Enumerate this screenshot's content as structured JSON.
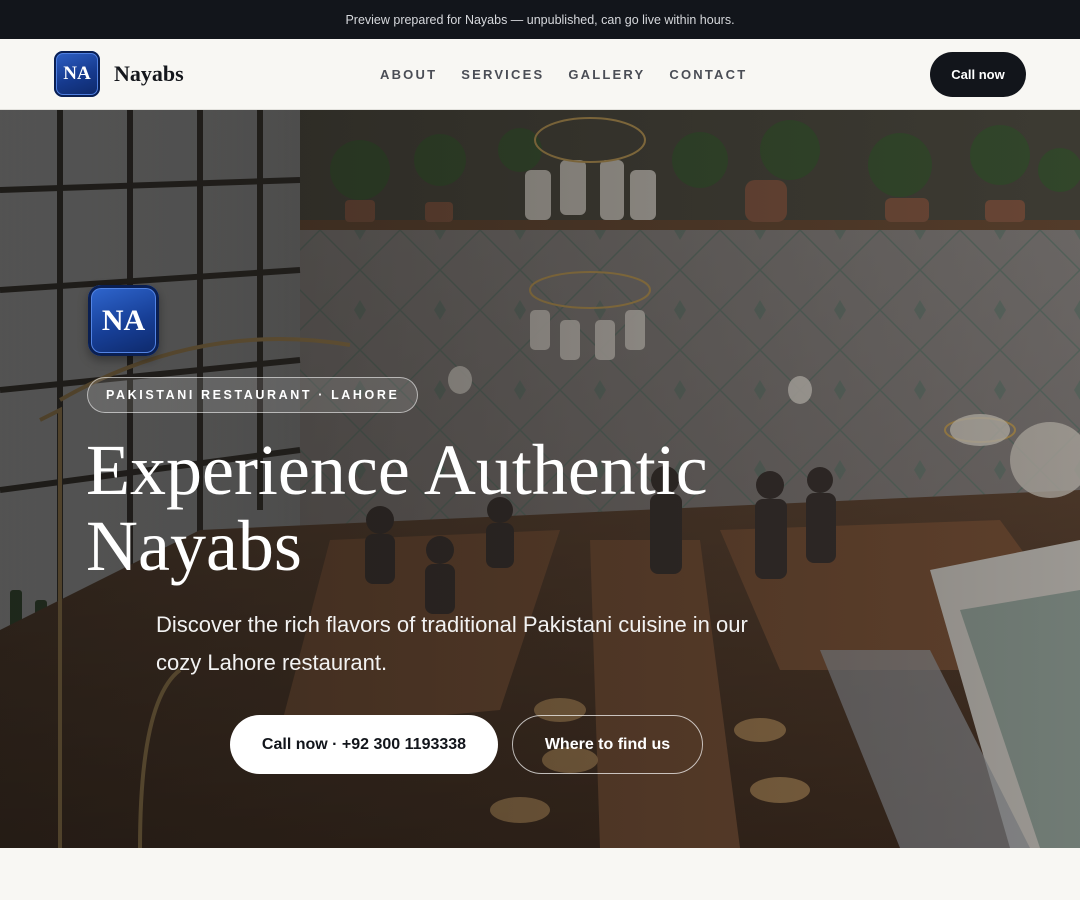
{
  "topbar": {
    "text": "Preview prepared for Nayabs — unpublished, can go live within hours."
  },
  "header": {
    "logo_initials": "NA",
    "brand_name": "Nayabs",
    "nav": [
      "ABOUT",
      "SERVICES",
      "GALLERY",
      "CONTACT"
    ],
    "call_button": "Call now"
  },
  "hero": {
    "logo_initials": "NA",
    "tag": "PAKISTANI RESTAURANT · LAHORE",
    "headline": "Experience Authentic Nayabs",
    "subtitle": "Discover the rich flavors of traditional Pakistani cuisine in our cozy Lahore restaurant.",
    "primary_cta": "Call now · +92 300 1193338",
    "secondary_cta": "Where to find us"
  },
  "colors": {
    "dark": "#12151b",
    "page_bg": "#f8f7f3",
    "logo_blue": "#163a8e"
  }
}
